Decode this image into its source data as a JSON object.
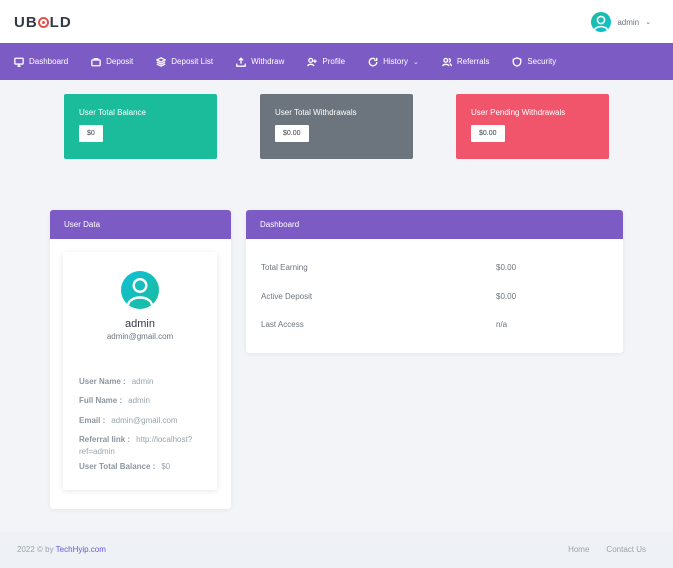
{
  "brand": {
    "logo_pre": "UB",
    "logo_post": "LD"
  },
  "topbar": {
    "username": "admin",
    "chevron": "⌄"
  },
  "nav": {
    "items": [
      {
        "label": "Dashboard",
        "icon": "monitor-icon"
      },
      {
        "label": "Deposit",
        "icon": "briefcase-icon"
      },
      {
        "label": "Deposit List",
        "icon": "layers-icon"
      },
      {
        "label": "Withdraw",
        "icon": "upload-icon"
      },
      {
        "label": "Profile",
        "icon": "user-plus-icon"
      },
      {
        "label": "History",
        "icon": "refresh-icon",
        "chevron": "⌄"
      },
      {
        "label": "Referrals",
        "icon": "users-icon"
      },
      {
        "label": "Security",
        "icon": "shield-icon"
      }
    ],
    "accent": "#7d5bc4"
  },
  "stats": [
    {
      "label": "User Total Balance",
      "value": "$0",
      "color": "#1abc9c"
    },
    {
      "label": "User Total Withdrawals",
      "value": "$0.00",
      "color": "#6c757d"
    },
    {
      "label": "User Pending Withdrawals",
      "value": "$0.00",
      "color": "#f1556c"
    }
  ],
  "user_data": {
    "title": "User Data",
    "name": "admin",
    "email": "admin@gmail.com",
    "fields": [
      {
        "label": "User Name :",
        "value": "admin"
      },
      {
        "label": "Full Name :",
        "value": "admin"
      },
      {
        "label": "Email :",
        "value": "admin@gmail.com"
      },
      {
        "label": "Referral link :",
        "value": "http://localhost?ref=admin"
      },
      {
        "label": "User Total Balance :",
        "value": "$0"
      }
    ]
  },
  "dashboard": {
    "title": "Dashboard",
    "rows": [
      {
        "label": "Total Earning",
        "value": "$0.00"
      },
      {
        "label": "Active Deposit",
        "value": "$0.00"
      },
      {
        "label": "Last Access",
        "value": "n/a"
      }
    ]
  },
  "footer": {
    "copyright": "2022 © by",
    "company": "TechHyip.com",
    "links": [
      "Home",
      "Contact Us"
    ]
  }
}
